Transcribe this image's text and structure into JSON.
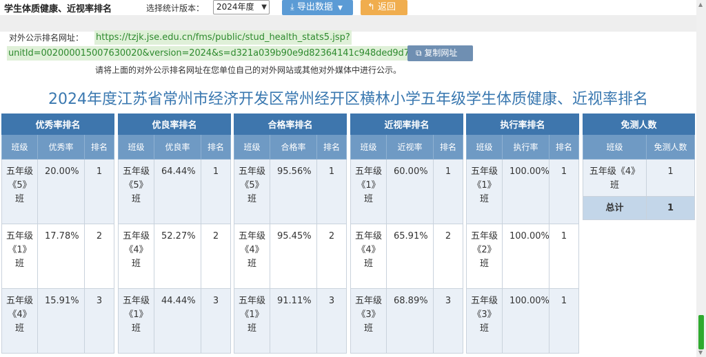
{
  "header": {
    "title": "学生体质健康、近视率排名",
    "version_label": "选择统计版本：",
    "version_selected": "2024年度",
    "export_label": "导出数据",
    "back_label": "返回"
  },
  "url": {
    "label": "对外公示排名网址：",
    "line1": "https://tzjk.jse.edu.cn/fms/public/stud_health_stats5.jsp?",
    "line2": "unitId=002000015007630020&version=2024&s=d321a039b90e9d82364141c948ded9d7",
    "copy_label": "复制网址",
    "note": "请将上面的对外公示排名网址在您单位自己的对外网站或其他对外媒体中进行公示。"
  },
  "page_title": "2024年度江苏省常州市经济开发区常州经开区横林小学五年级学生体质健康、近视率排名",
  "tables": [
    {
      "title": "优秀率排名",
      "col_class": "班级",
      "col_value": "优秀率",
      "col_rank": "排名",
      "rows": [
        {
          "class": "五年级《5》班",
          "value": "20.00%",
          "rank": "1"
        },
        {
          "class": "五年级《1》班",
          "value": "17.78%",
          "rank": "2"
        },
        {
          "class": "五年级《4》班",
          "value": "15.91%",
          "rank": "3"
        }
      ]
    },
    {
      "title": "优良率排名",
      "col_class": "班级",
      "col_value": "优良率",
      "col_rank": "排名",
      "rows": [
        {
          "class": "五年级《5》班",
          "value": "64.44%",
          "rank": "1"
        },
        {
          "class": "五年级《4》班",
          "value": "52.27%",
          "rank": "2"
        },
        {
          "class": "五年级《1》班",
          "value": "44.44%",
          "rank": "3"
        }
      ]
    },
    {
      "title": "合格率排名",
      "col_class": "班级",
      "col_value": "合格率",
      "col_rank": "排名",
      "rows": [
        {
          "class": "五年级《5》班",
          "value": "95.56%",
          "rank": "1"
        },
        {
          "class": "五年级《4》班",
          "value": "95.45%",
          "rank": "2"
        },
        {
          "class": "五年级《1》班",
          "value": "91.11%",
          "rank": "3"
        }
      ]
    },
    {
      "title": "近视率排名",
      "col_class": "班级",
      "col_value": "近视率",
      "col_rank": "排名",
      "rows": [
        {
          "class": "五年级《1》班",
          "value": "60.00%",
          "rank": "1"
        },
        {
          "class": "五年级《4》班",
          "value": "65.91%",
          "rank": "2"
        },
        {
          "class": "五年级《3》班",
          "value": "68.89%",
          "rank": "3"
        }
      ]
    },
    {
      "title": "执行率排名",
      "col_class": "班级",
      "col_value": "执行率",
      "col_rank": "排名",
      "rows": [
        {
          "class": "五年级《1》班",
          "value": "100.00%",
          "rank": "1"
        },
        {
          "class": "五年级《2》班",
          "value": "100.00%",
          "rank": "1"
        },
        {
          "class": "五年级《3》班",
          "value": "100.00%",
          "rank": "1"
        }
      ]
    }
  ],
  "exempt": {
    "title": "免测人数",
    "col_class": "班级",
    "col_count": "免测人数",
    "rows": [
      {
        "class": "五年级《4》班",
        "count": "1"
      }
    ],
    "total_label": "总计",
    "total_value": "1"
  }
}
